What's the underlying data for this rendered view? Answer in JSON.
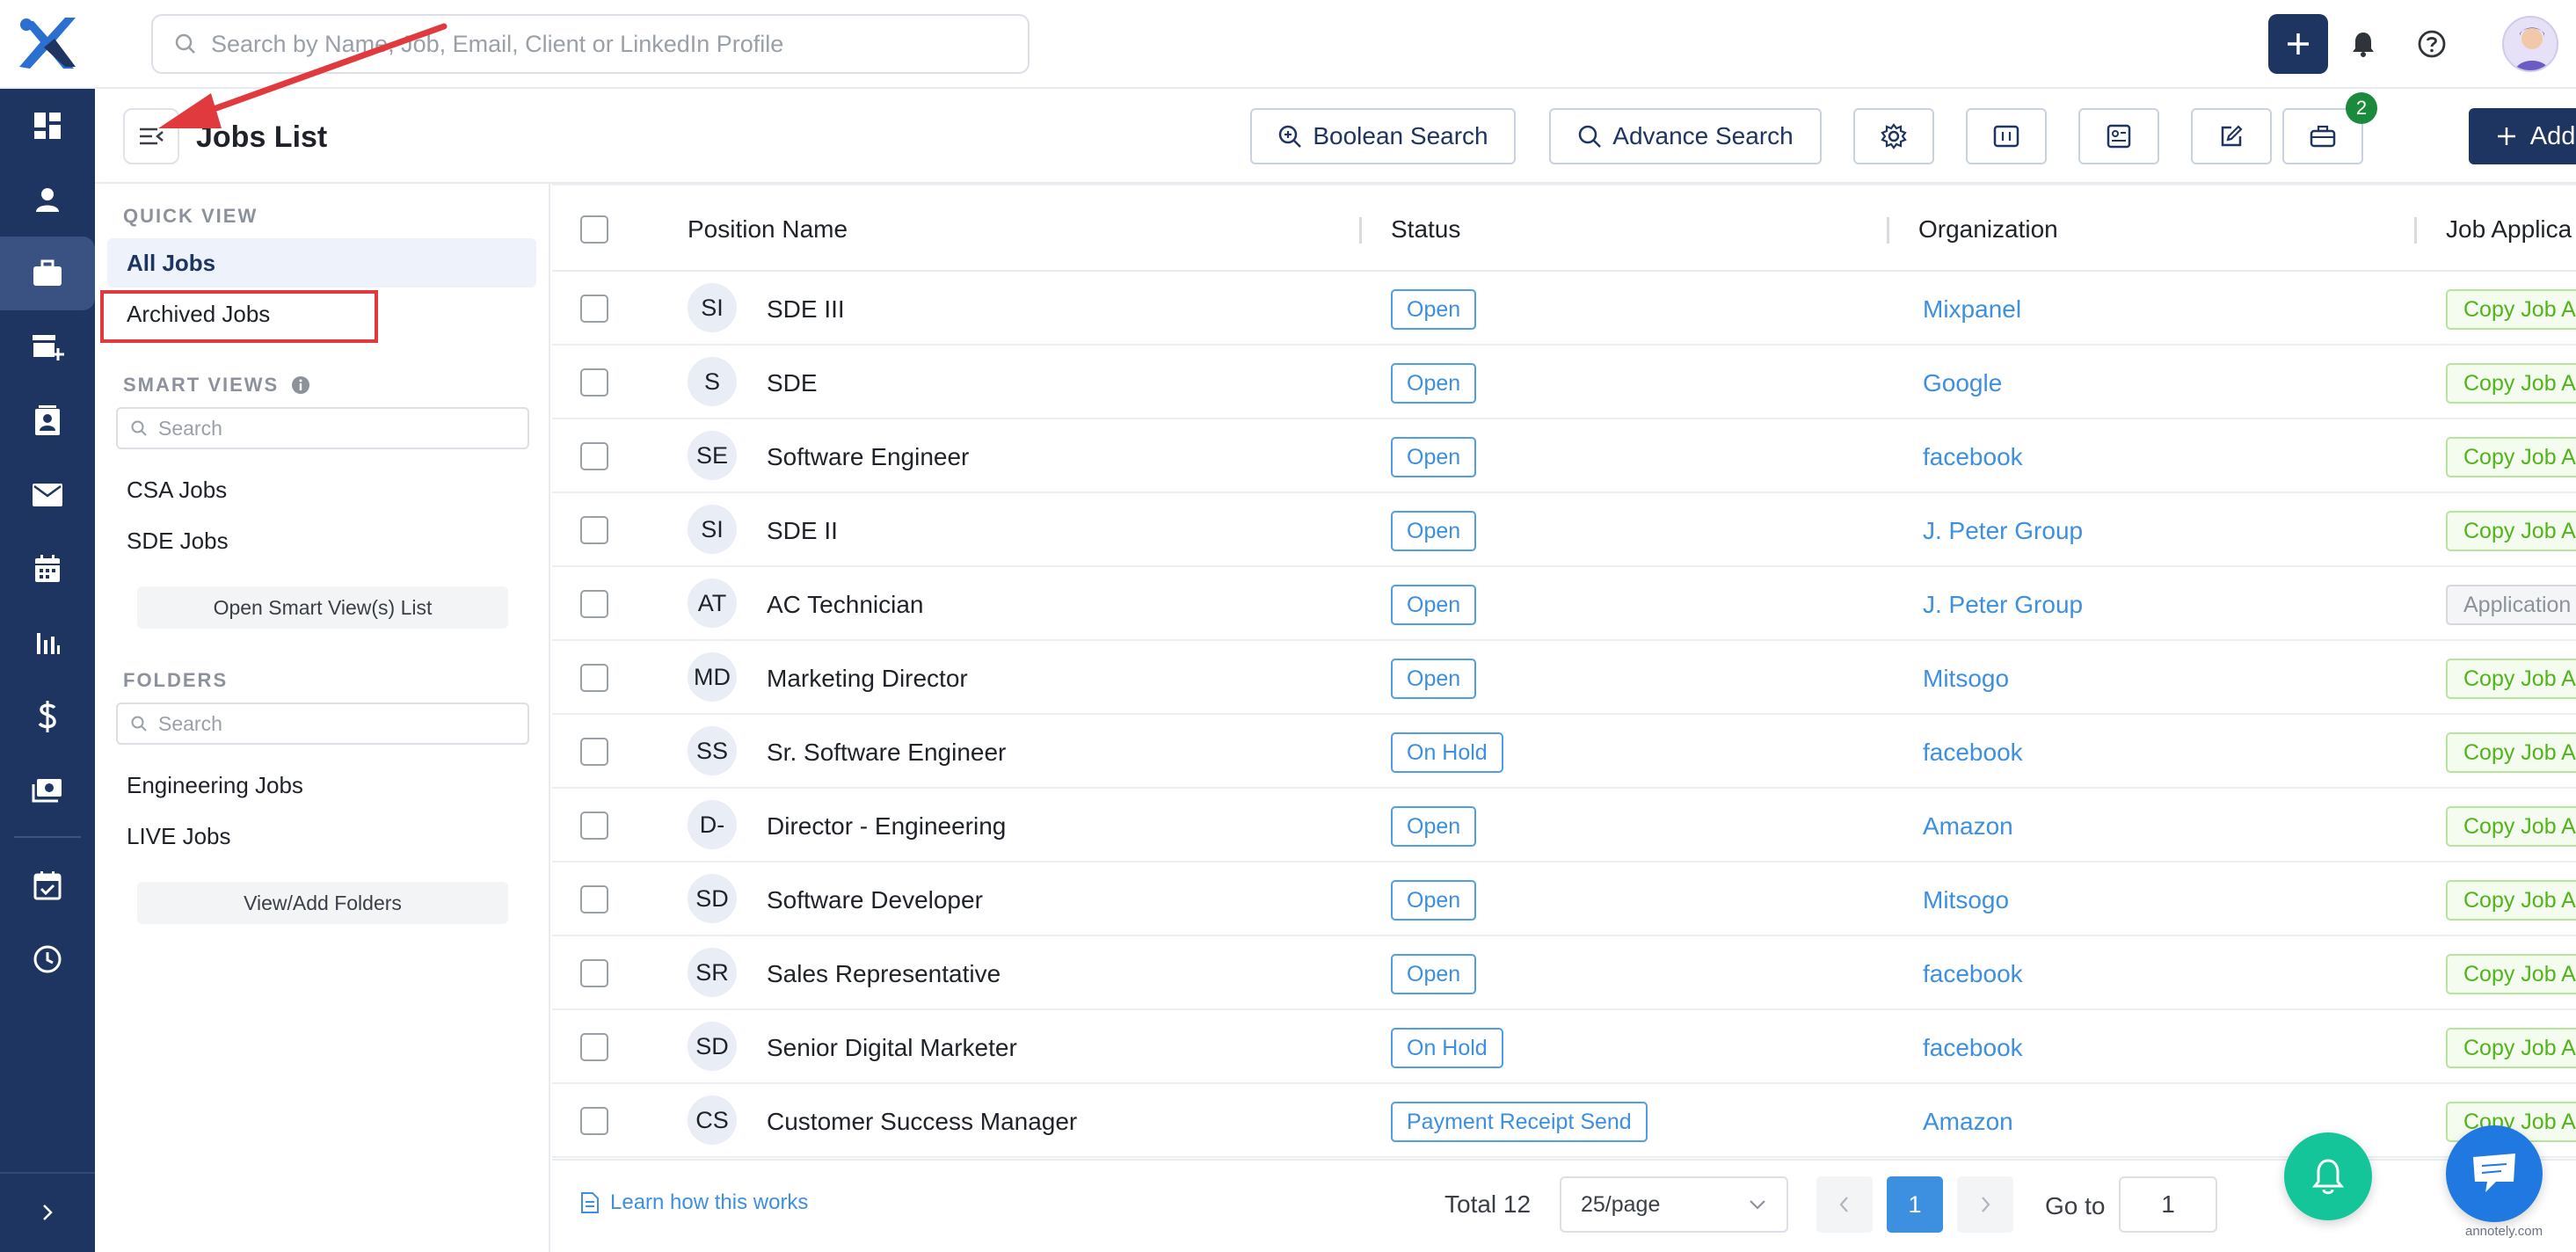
{
  "search": {
    "placeholder": "Search by Name, Job, Email, Client or LinkedIn Profile"
  },
  "header": {
    "title": "Jobs List"
  },
  "toolbar": {
    "boolean_search": "Boolean Search",
    "advance_search": "Advance Search",
    "badge_count": "2",
    "add_job": "Add Job"
  },
  "sidebar": {
    "quick_view_label": "QUICK VIEW",
    "all_jobs": "All Jobs",
    "archived_jobs": "Archived Jobs",
    "smart_views_label": "SMART VIEWS",
    "smart_search_placeholder": "Search",
    "smart_views": [
      "CSA Jobs",
      "SDE Jobs"
    ],
    "open_smart_views": "Open Smart View(s) List",
    "folders_label": "FOLDERS",
    "folder_search_placeholder": "Search",
    "folders": [
      "Engineering Jobs",
      "LIVE Jobs"
    ],
    "view_add_folders": "View/Add Folders"
  },
  "table": {
    "columns": [
      "Position Name",
      "Status",
      "Organization",
      "Job Applica"
    ],
    "rows": [
      {
        "initials": "SI",
        "position": "SDE III",
        "status": "Open",
        "organization": "Mixpanel",
        "application": "Copy Job A"
      },
      {
        "initials": "S",
        "position": "SDE",
        "status": "Open",
        "organization": "Google",
        "application": "Copy Job A"
      },
      {
        "initials": "SE",
        "position": "Software Engineer",
        "status": "Open",
        "organization": "facebook",
        "application": "Copy Job A"
      },
      {
        "initials": "SI",
        "position": "SDE II",
        "status": "Open",
        "organization": "J. Peter Group",
        "application": "Copy Job A"
      },
      {
        "initials": "AT",
        "position": "AC Technician",
        "status": "Open",
        "organization": "J. Peter Group",
        "application": "Application"
      },
      {
        "initials": "MD",
        "position": "Marketing Director",
        "status": "Open",
        "organization": "Mitsogo",
        "application": "Copy Job A"
      },
      {
        "initials": "SS",
        "position": "Sr. Software Engineer",
        "status": "On Hold",
        "organization": "facebook",
        "application": "Copy Job A"
      },
      {
        "initials": "D-",
        "position": "Director - Engineering",
        "status": "Open",
        "organization": "Amazon",
        "application": "Copy Job A"
      },
      {
        "initials": "SD",
        "position": "Software Developer",
        "status": "Open",
        "organization": "Mitsogo",
        "application": "Copy Job A"
      },
      {
        "initials": "SR",
        "position": "Sales Representative",
        "status": "Open",
        "organization": "facebook",
        "application": "Copy Job A"
      },
      {
        "initials": "SD",
        "position": "Senior Digital Marketer",
        "status": "On Hold",
        "organization": "facebook",
        "application": "Copy Job A"
      },
      {
        "initials": "CS",
        "position": "Customer Success Manager",
        "status": "Payment Receipt Send",
        "organization": "Amazon",
        "application": "Copy Job A"
      }
    ]
  },
  "footer": {
    "learn_link": "Learn how this works",
    "total": "Total 12",
    "per_page": "25/page",
    "current_page": "1",
    "goto_label": "Go to",
    "goto_value": "1"
  },
  "watermark": "annotely.com",
  "colors": {
    "navy": "#1e3461",
    "accent": "#3d8fdf",
    "success": "#52b41a",
    "annotation_red": "#e0393e",
    "fab_green": "#15c59a"
  }
}
